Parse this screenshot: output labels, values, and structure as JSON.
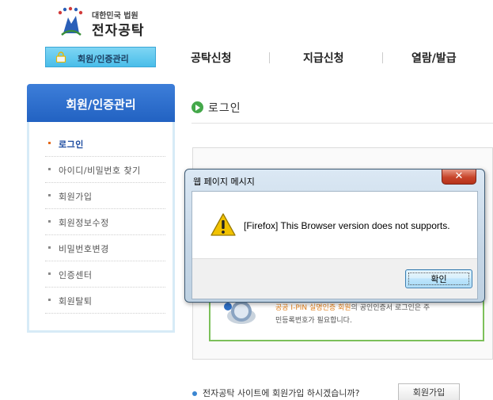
{
  "header": {
    "logo_small": "대한민국 법원",
    "logo_big": "전자공탁"
  },
  "nav": {
    "member": "회원/인증관리",
    "items": [
      "공탁신청",
      "지급신청",
      "열람/발급"
    ]
  },
  "sidebar": {
    "title": "회원/인증관리",
    "items": [
      {
        "label": "로그인",
        "active": true
      },
      {
        "label": "아이디/비밀번호 찾기"
      },
      {
        "label": "회원가입"
      },
      {
        "label": "회원정보수정"
      },
      {
        "label": "비밀번호변경"
      },
      {
        "label": "인증센터"
      },
      {
        "label": "회원탈퇴"
      }
    ]
  },
  "main": {
    "page_title": "로그인",
    "ipin_line1_highlight": "공공 I-PIN 실명인증 회원",
    "ipin_line1_rest": "의 공인인증서 로그인은 주",
    "ipin_line2": "민등록번호가 필요합니다.",
    "bottom_question": "전자공탁 사이트에 회원가입 하시겠습니까?",
    "join_button": "회원가입"
  },
  "dialog": {
    "title": "웹 페이지 메시지",
    "message": "[Firefox] This Browser version does not supports.",
    "ok": "확인",
    "close_glyph": "✕"
  },
  "colors": {
    "sidebar_header": "#2f6fcf",
    "nav_active": "#5fc8f0",
    "active_item": "#1c4ba0",
    "green_border": "#7cc05a",
    "warning": "#f2c200"
  }
}
